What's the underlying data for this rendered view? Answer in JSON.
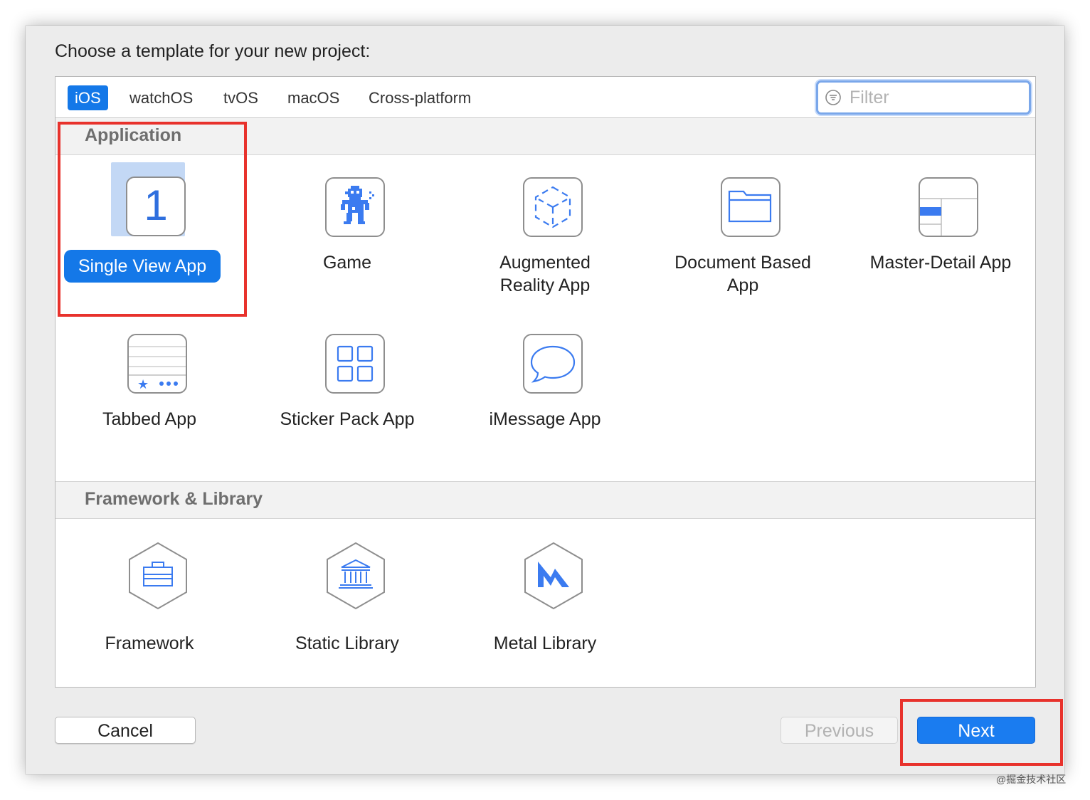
{
  "dialog": {
    "prompt": "Choose a template for your new project:"
  },
  "tabs": [
    {
      "label": "iOS",
      "active": true
    },
    {
      "label": "watchOS"
    },
    {
      "label": "tvOS"
    },
    {
      "label": "macOS"
    },
    {
      "label": "Cross-platform"
    }
  ],
  "filter": {
    "placeholder": "Filter",
    "icon": "filter-icon"
  },
  "sections": {
    "application": {
      "title": "Application",
      "templates": [
        {
          "label": "Single View App",
          "icon": "single-view-icon",
          "selected": true,
          "glyph": "1"
        },
        {
          "label": "Game",
          "icon": "game-icon"
        },
        {
          "label": "Augmented Reality App",
          "icon": "augmented-reality-icon"
        },
        {
          "label": "Document Based App",
          "icon": "document-folder-icon"
        },
        {
          "label": "Master-Detail App",
          "icon": "master-detail-icon"
        },
        {
          "label": "Tabbed App",
          "icon": "tabbed-app-icon"
        },
        {
          "label": "Sticker Pack App",
          "icon": "sticker-grid-icon"
        },
        {
          "label": "iMessage App",
          "icon": "message-bubble-icon"
        }
      ]
    },
    "framework": {
      "title": "Framework & Library",
      "templates": [
        {
          "label": "Framework",
          "icon": "toolbox-icon"
        },
        {
          "label": "Static Library",
          "icon": "library-building-icon"
        },
        {
          "label": "Metal Library",
          "icon": "metal-icon"
        }
      ]
    }
  },
  "buttons": {
    "cancel": "Cancel",
    "previous": "Previous",
    "next": "Next"
  },
  "colors": {
    "accent": "#1478e8",
    "selection_bg": "#c3d8f5",
    "callout": "#e8322c",
    "icon_blue": "#3b7bf0"
  },
  "watermark": "@掘金技术社区"
}
